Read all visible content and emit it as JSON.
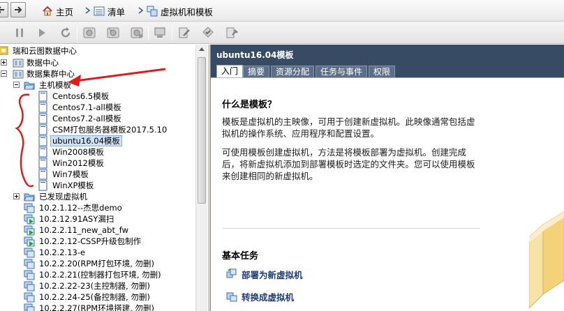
{
  "breadcrumb": {
    "home": "主页",
    "inventory": "清单",
    "current": "虚拟机和模板"
  },
  "tree": {
    "root": "瑞和云图数据中心",
    "items": [
      {
        "label": "数据中心"
      },
      {
        "label": "数据集群中心"
      },
      {
        "label": "主机模板"
      },
      {
        "label": "Centos6.5模板"
      },
      {
        "label": "Centos7.1-all模板"
      },
      {
        "label": "Centos7.2-all模板"
      },
      {
        "label": "CSM打包服务器模板2017.5.10"
      },
      {
        "label": "ubuntu16.04模板"
      },
      {
        "label": "Win2008模板"
      },
      {
        "label": "Win2012模板"
      },
      {
        "label": "Win7模板"
      },
      {
        "label": "WinXP模板"
      },
      {
        "label": "已发现虚拟机"
      },
      {
        "label": "10.2.1.12--杰思demo"
      },
      {
        "label": "10.2.12.91ASY漏扫"
      },
      {
        "label": "10.2.2.11_new_abt_fw"
      },
      {
        "label": "10.2.2.12-CSSP升级包制作"
      },
      {
        "label": "10.2.2.13-e"
      },
      {
        "label": "10.2.2.20(RPM打包环境, 勿删)"
      },
      {
        "label": "10.2.2.21(控制器打包环境, 勿删)"
      },
      {
        "label": "10.2.2.22-23(主控制器, 勿删)"
      },
      {
        "label": "10.2.2.24-25(备控制器, 勿删)"
      },
      {
        "label": "10.2.2.27(RPM环境搭建, 勿删)"
      }
    ]
  },
  "panel": {
    "title": "ubuntu16.04模板",
    "tabs": [
      "入门",
      "摘要",
      "资源分配",
      "任务与事件",
      "权限"
    ],
    "help_title": "什么是模板？",
    "para1": "模板是虚拟机的主映像，可用于创建新虚拟机。此映像通常包括虚拟机的操作系统、应用程序和配置设置。",
    "para2": "可使用模板创建虚拟机，方法是将模板部署为虚拟机。创建完成后，将新虚拟机添加到部署模板时选定的文件夹。您可以使用模板来创建相同的新虚拟机。",
    "tasks_title": "基本任务",
    "task_deploy": "部署为新虚拟机",
    "task_convert": "转换成虚拟机"
  },
  "colors": {
    "header_bg": "#374b65",
    "annotation_red": "#e21b1b",
    "link": "#1f3d73"
  },
  "icons": [
    "back-arrow-icon",
    "forward-arrow-icon",
    "home-icon",
    "inventory-icon",
    "vm-templates-icon",
    "pause-icon",
    "play-icon",
    "refresh-icon",
    "snapshot-icon",
    "console-icon",
    "template-icon",
    "datacenter-icon",
    "folder-icon",
    "vm-icon",
    "template-doc-icon",
    "deploy-icon",
    "convert-icon"
  ]
}
